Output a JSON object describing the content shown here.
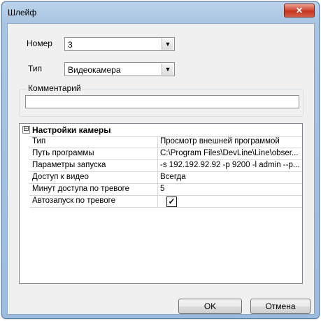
{
  "window": {
    "title": "Шлейф",
    "close_glyph": "✕"
  },
  "fields": {
    "number_label": "Номер",
    "number_value": "3",
    "type_label": "Тип",
    "type_value": "Видеокамера",
    "comment_label": "Комментарий",
    "comment_value": ""
  },
  "properties": {
    "category_expander": "⊟",
    "category": "Настройки камеры",
    "rows": [
      {
        "name": "Тип",
        "value": "Просмотр внешней программой"
      },
      {
        "name": "Путь программы",
        "value": "C:\\Program Files\\DevLine\\Line\\obser..."
      },
      {
        "name": "Параметры запуска",
        "value": "-s 192.192.92.92 -p 9200 -l admin --p..."
      },
      {
        "name": "Доступ к видео",
        "value": "Всегда"
      },
      {
        "name": "Минут доступа по тревоге",
        "value": "5"
      },
      {
        "name": "Автозапуск по тревоге",
        "checked": true,
        "check_glyph": "✓"
      }
    ]
  },
  "buttons": {
    "ok": "OK",
    "cancel": "Отмена"
  },
  "icons": {
    "dropdown": "▼"
  }
}
